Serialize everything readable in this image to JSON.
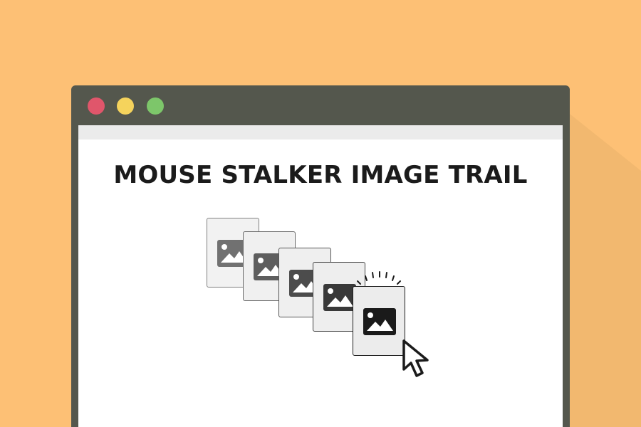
{
  "page": {
    "title": "MOUSE STALKER IMAGE TRAIL"
  },
  "window": {
    "controls": [
      {
        "name": "close",
        "color": "#E0566B"
      },
      {
        "name": "minimize",
        "color": "#F5D35C"
      },
      {
        "name": "maximize",
        "color": "#7DC66A"
      }
    ]
  },
  "colors": {
    "background": "#FDC075",
    "window_frame": "#54574D",
    "viewport": "#FFFFFF",
    "toolbar_strip": "#EBEBEB",
    "title_text": "#1B1B1B"
  },
  "trail": {
    "cards": [
      {
        "name": "trail-card-1",
        "opacity": 0.3,
        "icon": "image-icon"
      },
      {
        "name": "trail-card-2",
        "opacity": 0.45,
        "icon": "image-icon"
      },
      {
        "name": "trail-card-3",
        "opacity": 0.6,
        "icon": "image-icon"
      },
      {
        "name": "trail-card-4",
        "opacity": 0.75,
        "icon": "image-icon"
      },
      {
        "name": "trail-card-5",
        "opacity": 1.0,
        "icon": "image-icon"
      }
    ],
    "pointer_icon": "arrow-cursor-icon",
    "burst_icon": "sparkle-icon"
  }
}
